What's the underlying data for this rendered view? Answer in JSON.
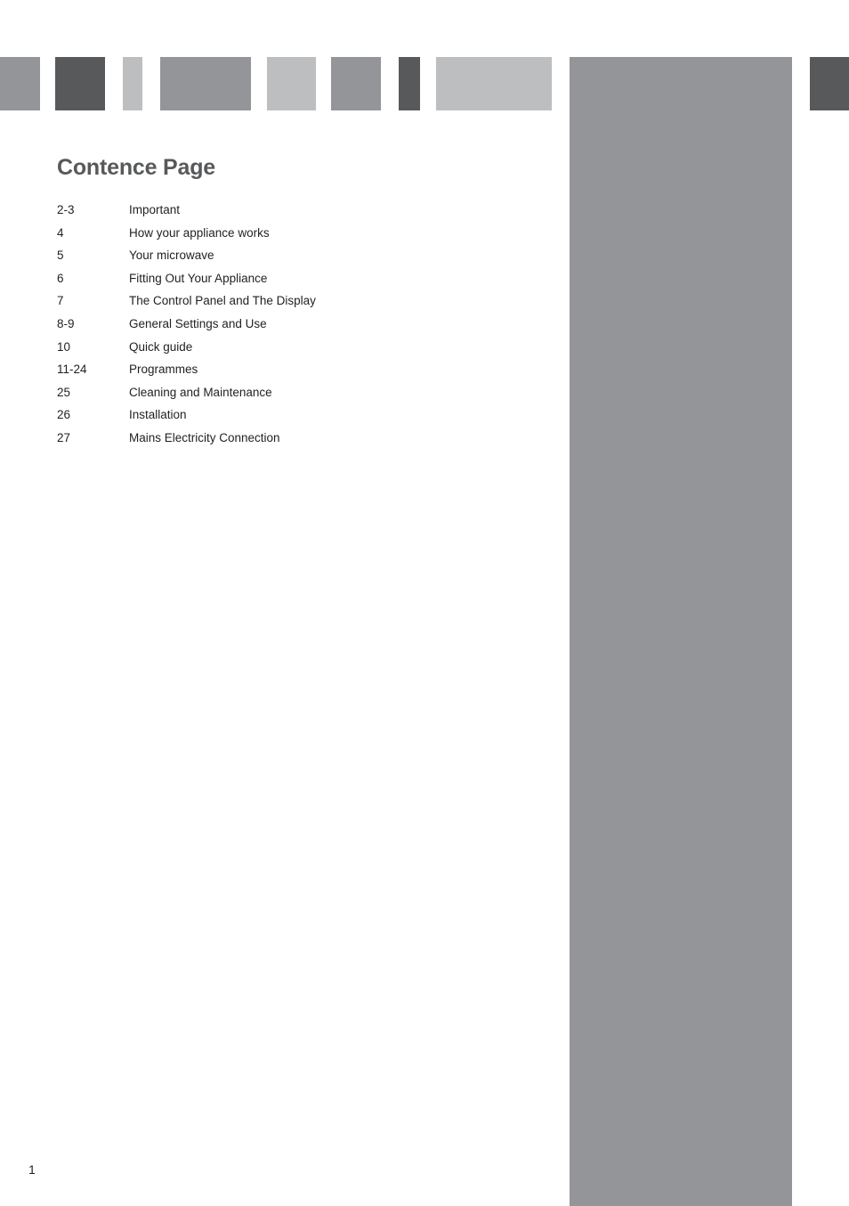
{
  "document": {
    "title": "Contence Page",
    "folio": "1"
  },
  "contents": [
    {
      "pages": "2-3",
      "title": "Important"
    },
    {
      "pages": "4",
      "title": "How your appliance works"
    },
    {
      "pages": "5",
      "title": "Your microwave"
    },
    {
      "pages": "6",
      "title": "Fitting Out Your Appliance"
    },
    {
      "pages": "7",
      "title": "The Control Panel and The Display"
    },
    {
      "pages": "8-9",
      "title": "General Settings and Use"
    },
    {
      "pages": "10",
      "title": "Quick guide"
    },
    {
      "pages": "11-24",
      "title": "Programmes"
    },
    {
      "pages": "25",
      "title": "Cleaning and Maintenance"
    },
    {
      "pages": "26",
      "title": "Installation"
    },
    {
      "pages": "27",
      "title": "Mains Electricity Connection"
    }
  ],
  "decoration": {
    "bars": [
      {
        "name": "header-bar-1",
        "color": "#939598"
      },
      {
        "name": "header-bar-2",
        "color": "#58595b"
      },
      {
        "name": "header-bar-3",
        "color": "#bcbec0"
      },
      {
        "name": "header-bar-4",
        "color": "#939598"
      },
      {
        "name": "header-bar-5",
        "color": "#bcbec0"
      },
      {
        "name": "header-bar-6",
        "color": "#939598"
      },
      {
        "name": "header-bar-7",
        "color": "#58595b"
      },
      {
        "name": "header-bar-8",
        "color": "#bcbec0"
      },
      {
        "name": "side-panel",
        "color": "#939598"
      },
      {
        "name": "header-bar-9",
        "color": "#58595b"
      }
    ]
  },
  "colors": {
    "title_text": "#58595b",
    "body_text": "#231f20",
    "mid_gray": "#939598",
    "dark_gray": "#58595b",
    "light_gray": "#bcbec0",
    "page_background": "#ffffff"
  }
}
